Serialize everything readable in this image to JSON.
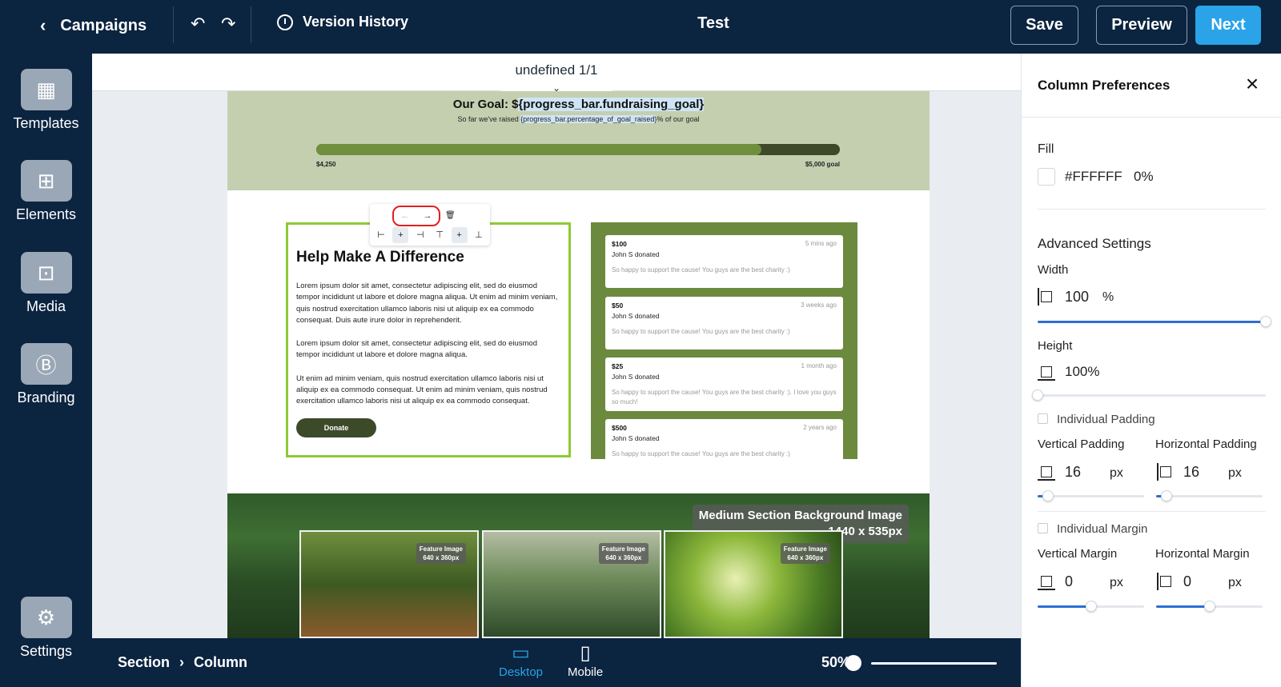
{
  "topbar": {
    "back_label": "Campaigns",
    "history_label": "Version History",
    "title": "Test",
    "save_label": "Save",
    "preview_label": "Preview",
    "next_label": "Next"
  },
  "rail": {
    "items": [
      {
        "label": "Templates",
        "icon": "layout-icon"
      },
      {
        "label": "Elements",
        "icon": "elements-icon"
      },
      {
        "label": "Media",
        "icon": "image-add-icon"
      },
      {
        "label": "Branding",
        "icon": "brand-icon"
      },
      {
        "label": "Settings",
        "icon": "gear-icon"
      }
    ]
  },
  "canvas": {
    "pager_label": "undefined 1/1",
    "goal": {
      "title_prefix": "Our Goal: $",
      "title_var": "{progress_bar.fundraising_goal}",
      "subtitle_prefix": "So far we've raised ",
      "subtitle_var": "{progress_bar.percentage_of_goal_raised}",
      "subtitle_suffix": "% of our goal",
      "progress": 0.85,
      "raised_label": "$4,250",
      "goal_label": "$5,000 goal"
    },
    "help": {
      "title": "Help Make A Difference",
      "p1": "Lorem ipsum dolor sit amet, consectetur adipiscing elit, sed do eiusmod tempor incididunt ut labore et dolore magna aliqua. Ut enim ad minim veniam, quis nostrud exercitation ullamco laboris nisi ut aliquip ex ea commodo consequat. Duis aute irure dolor in reprehenderit.",
      "p2": "Lorem ipsum dolor sit amet, consectetur adipiscing elit, sed do eiusmod tempor incididunt ut labore et dolore magna aliqua.",
      "p3": "Ut enim ad minim veniam, quis nostrud exercitation ullamco laboris nisi ut aliquip ex ea commodo consequat. Ut enim ad minim veniam, quis nostrud exercitation ullamco laboris nisi ut aliquip ex ea commodo consequat.",
      "donate_label": "Donate"
    },
    "donations": [
      {
        "amount": "$100",
        "time": "5 mins ago",
        "donor": "John S donated",
        "message": "So happy to support the cause! You guys are the best charity :)"
      },
      {
        "amount": "$50",
        "time": "3 weeks ago",
        "donor": "John S donated",
        "message": "So happy to support the cause! You guys are the best charity :)"
      },
      {
        "amount": "$25",
        "time": "1 month ago",
        "donor": "John S donated",
        "message": "So happy to support the cause! You guys are the best charity :). I love you guys so much!"
      },
      {
        "amount": "$500",
        "time": "2 years ago",
        "donor": "John S donated",
        "message": "So happy to support the cause! You guys are the best charity :)"
      }
    ],
    "background_badge_line1": "Medium Section Background Image",
    "background_badge_line2": "1440 x 535px",
    "features": [
      {
        "badge_line1": "Feature Image",
        "badge_line2": "640 x 360px"
      },
      {
        "badge_line1": "Feature Image",
        "badge_line2": "640 x 360px"
      },
      {
        "badge_line1": "Feature Image",
        "badge_line2": "640 x 360px"
      }
    ]
  },
  "bottombar": {
    "crumb_section": "Section",
    "crumb_sep": "›",
    "crumb_column": "Column",
    "desktop_label": "Desktop",
    "mobile_label": "Mobile",
    "zoom_label": "50%",
    "zoom_value": 0.5
  },
  "panel": {
    "title": "Column Preferences",
    "fill_label": "Fill",
    "fill_hex": "#FFFFFF",
    "fill_opacity": "0%",
    "advanced_label": "Advanced Settings",
    "width_label": "Width",
    "width_value": "100",
    "width_unit": "%",
    "width_level": 1.0,
    "height_label": "Height",
    "height_value": "100%",
    "height_level": 0.0,
    "individual_padding_label": "Individual Padding",
    "vpad_label": "Vertical Padding",
    "hpad_label": "Horizontal Padding",
    "vpad_value": "16",
    "hpad_value": "16",
    "px_unit": "px",
    "vpad_level": 0.1,
    "hpad_level": 0.1,
    "individual_margin_label": "Individual Margin",
    "vmargin_label": "Vertical Margin",
    "hmargin_label": "Horizontal Margin",
    "vmargin_value": "0",
    "hmargin_value": "0",
    "vmargin_level": 0.5,
    "hmargin_level": 0.5
  },
  "colors": {
    "brand_dark": "#0b2440",
    "accent": "#2aa3e8",
    "selection_green": "#8ccb35",
    "selection_red": "#e02020"
  }
}
